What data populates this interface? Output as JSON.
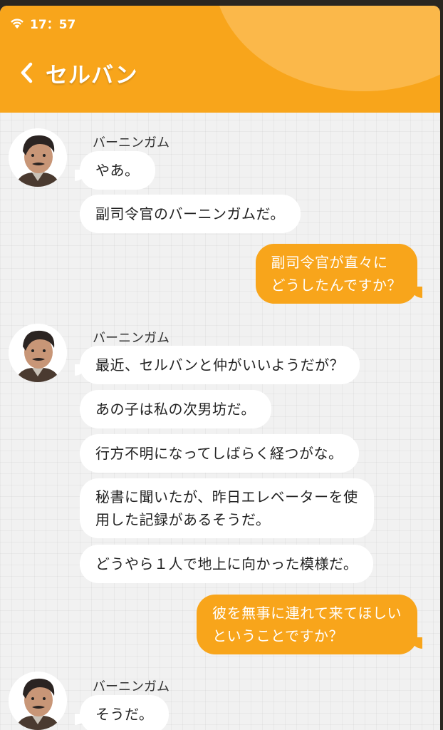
{
  "status_bar": {
    "time": "17：57"
  },
  "header": {
    "title": "セルバン"
  },
  "chat": {
    "group1": {
      "name": "バーニンガム",
      "messages": [
        "やあ。",
        "副司令官のバーニンガムだ。"
      ]
    },
    "reply1": "副司令官が直々に\nどうしたんですか？",
    "group2": {
      "name": "バーニンガム",
      "messages": [
        "最近、セルバンと仲がいいようだが？",
        "あの子は私の次男坊だ。",
        "行方不明になってしばらく経つがな。",
        "秘書に聞いたが、昨日エレベーターを使\n用した記録があるそうだ。",
        "どうやら１人で地上に向かった模様だ。"
      ]
    },
    "reply2": "彼を無事に連れて来てほしい\nということですか？",
    "group3": {
      "name": "バーニンガム",
      "messages": [
        "そうだ。"
      ]
    }
  },
  "colors": {
    "accent": "#f8a51b",
    "background": "#f1f1f1",
    "bubble_in": "#ffffff"
  },
  "icons": {
    "status": "wifi-icon",
    "back": "chevron-left-icon",
    "avatar": "avatar"
  }
}
